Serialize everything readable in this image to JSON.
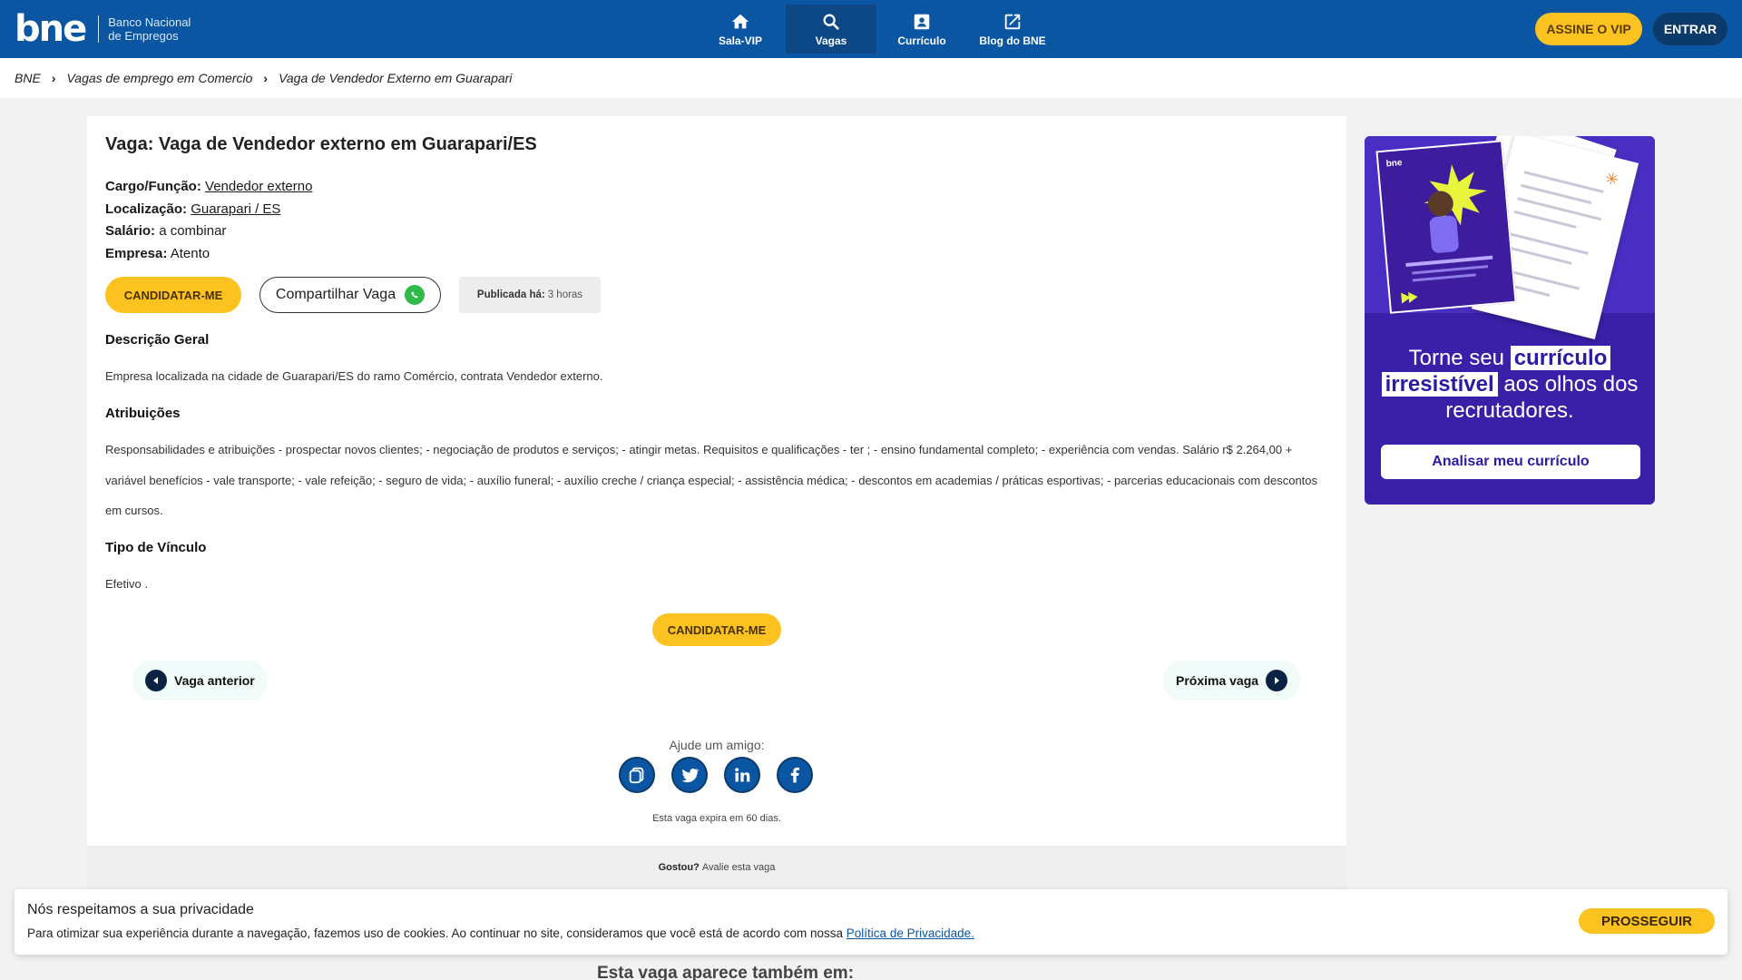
{
  "header": {
    "logo_mark": "bne",
    "logo_line1": "Banco Nacional",
    "logo_line2": "de Empregos",
    "nav": [
      {
        "label": "Sala-VIP",
        "icon": "home-icon"
      },
      {
        "label": "Vagas",
        "icon": "search-icon",
        "active": true
      },
      {
        "label": "Currículo",
        "icon": "badge-icon"
      },
      {
        "label": "Blog do BNE",
        "icon": "external-link-icon"
      }
    ],
    "vip_label": "ASSINE O VIP",
    "enter_label": "ENTRAR"
  },
  "breadcrumb": [
    "BNE",
    "Vagas de emprego em Comercio",
    "Vaga de Vendedor Externo em Guarapari"
  ],
  "job": {
    "title": "Vaga: Vaga de Vendedor externo em Guarapari/ES",
    "cargo_label": "Cargo/Função:",
    "cargo_value": "Vendedor externo",
    "local_label": "Localização:",
    "local_value": "Guarapari / ES",
    "salario_label": "Salário:",
    "salario_value": "a combinar",
    "empresa_label": "Empresa:",
    "empresa_value": "Atento",
    "apply_label": "CANDIDATAR-ME",
    "share_label": "Compartilhar Vaga",
    "published_label": "Publicada há:",
    "published_value": "3 horas",
    "desc_heading": "Descrição Geral",
    "desc_text": "Empresa localizada na cidade de Guarapari/ES do ramo Comércio, contrata Vendedor externo.",
    "attr_heading": "Atribuições",
    "attr_text": "Responsabilidades e atribuições - prospectar novos clientes; - negociação de produtos e serviços; - atingir metas. Requisitos e qualificações - ter ; - ensino fundamental completo; - experiência com vendas. Salário r$ 2.264,00 + variável benefícios - vale transporte; - vale refeição; - seguro de vida; - auxílio funeral; - auxílio creche / criança especial; - assistência médica; - descontos em academias / práticas esportivas; - parcerias educacionais com descontos em cursos.",
    "vinculo_heading": "Tipo de Vínculo",
    "vinculo_text": "Efetivo .",
    "prev_label": "Vaga anterior",
    "next_label": "Próxima vaga",
    "help_label": "Ajude um amigo:",
    "expire_text": "Esta vaga expira em 60 dias.",
    "rate_bold": "Gostou?",
    "rate_text": "Avalie esta vaga"
  },
  "ad": {
    "line1_pre": "Torne seu",
    "line1_hl": "currículo",
    "line2_hl": "irresistível",
    "line2_post": "aos olhos dos",
    "line3": "recrutadores.",
    "button": "Analisar meu currículo",
    "mini_logo": "bne"
  },
  "cookie": {
    "title": "Nós respeitamos a sua privacidade",
    "text": "Para otimizar sua experiência durante a navegação, fazemos uso de cookies. Ao continuar no site, consideramos que você está de acordo com nossa",
    "link": "Política de Privacidade.",
    "button": "PROSSEGUIR"
  },
  "also_heading": "Esta vaga aparece também em:"
}
